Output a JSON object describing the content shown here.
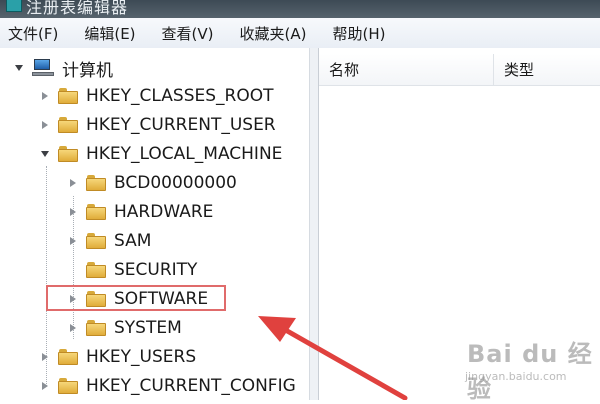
{
  "window": {
    "title": "注册表编辑器"
  },
  "menu": [
    "文件(F)",
    "编辑(E)",
    "查看(V)",
    "收藏夹(A)",
    "帮助(H)"
  ],
  "tree": {
    "root": "计算机",
    "nodes": [
      {
        "label": "HKEY_CLASSES_ROOT",
        "state": "collapsed"
      },
      {
        "label": "HKEY_CURRENT_USER",
        "state": "collapsed"
      },
      {
        "label": "HKEY_LOCAL_MACHINE",
        "state": "expanded"
      },
      {
        "label": "BCD00000000",
        "state": "collapsed"
      },
      {
        "label": "HARDWARE",
        "state": "collapsed"
      },
      {
        "label": "SAM",
        "state": "collapsed"
      },
      {
        "label": "SECURITY",
        "state": "none"
      },
      {
        "label": "SOFTWARE",
        "state": "collapsed",
        "highlighted": true
      },
      {
        "label": "SYSTEM",
        "state": "collapsed"
      },
      {
        "label": "HKEY_USERS",
        "state": "collapsed"
      },
      {
        "label": "HKEY_CURRENT_CONFIG",
        "state": "collapsed"
      }
    ]
  },
  "list": {
    "columns": [
      "名称",
      "类型"
    ]
  },
  "colors": {
    "highlight_border": "#e06b6b",
    "arrow": "#e0413e"
  },
  "watermark": {
    "main": "Bai du 经验",
    "sub": "jingyan.baidu.com"
  },
  "icons": {
    "root": "computer-icon",
    "folder": "folder-icon"
  }
}
